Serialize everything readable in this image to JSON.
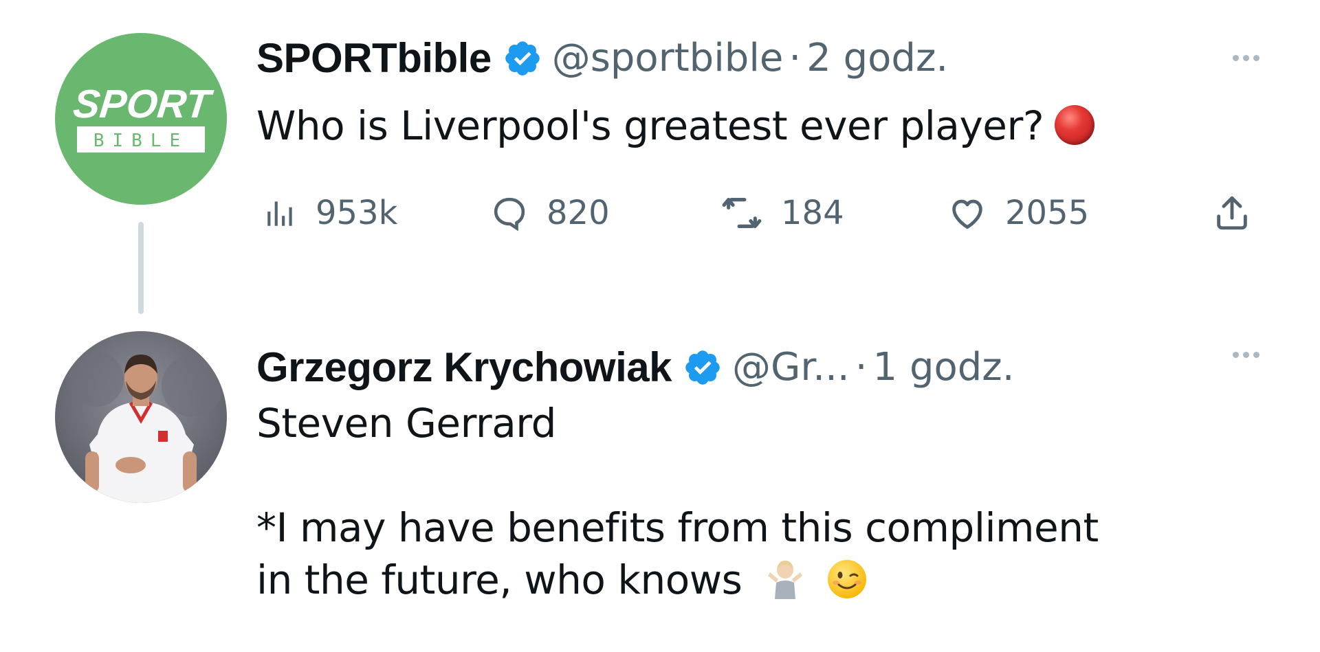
{
  "tweets": [
    {
      "author": {
        "display_name": "SPORTbible",
        "handle": "@sportbible",
        "verified": true,
        "avatar_text_top": "SPORT",
        "avatar_text_bottom": "BIBLE",
        "avatar_color": "#6ab86f"
      },
      "separator": "·",
      "time": "2 godz.",
      "text": "Who is Liverpool's greatest ever player?",
      "trailing_emoji": "red-circle",
      "stats": {
        "views": "953k",
        "replies": "820",
        "retweets": "184",
        "likes": "2055"
      }
    },
    {
      "author": {
        "display_name": "Grzegorz Krychowiak",
        "handle": "@Gr...",
        "verified": true
      },
      "separator": "·",
      "time": "1 godz.",
      "text_line1": "Steven Gerrard",
      "text_line2": "*I may have benefits from this compliment",
      "text_line3": "in the future, who knows",
      "trailing_emojis": [
        "person-shrugging",
        "winking-face"
      ]
    }
  ],
  "colors": {
    "verified_blue": "#1d9bf0",
    "secondary_text": "#536471",
    "thread_line": "#cfd9de"
  }
}
